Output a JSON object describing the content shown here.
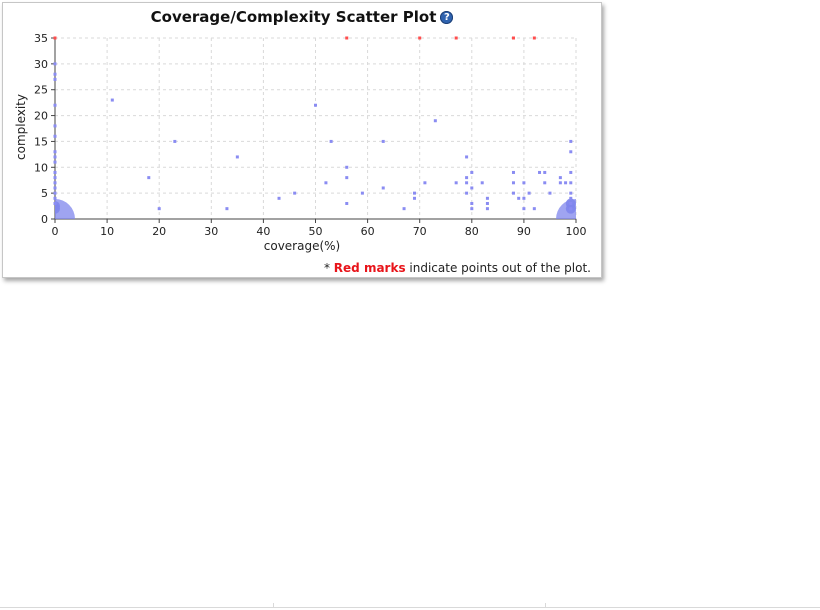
{
  "chart_data": {
    "type": "scatter",
    "title": "Coverage/Complexity Scatter Plot",
    "xlabel": "coverage(%)",
    "ylabel": "complexity",
    "xlim": [
      0,
      100
    ],
    "ylim": [
      0,
      35
    ],
    "xticks": [
      0,
      10,
      20,
      30,
      40,
      50,
      60,
      70,
      80,
      90,
      100
    ],
    "yticks": [
      0,
      5,
      10,
      15,
      20,
      25,
      30,
      35
    ],
    "grid": true,
    "points": [
      {
        "x": 0,
        "y": 30
      },
      {
        "x": 0,
        "y": 28
      },
      {
        "x": 0,
        "y": 27
      },
      {
        "x": 0,
        "y": 22
      },
      {
        "x": 0,
        "y": 18
      },
      {
        "x": 0,
        "y": 16
      },
      {
        "x": 0,
        "y": 13
      },
      {
        "x": 0,
        "y": 12
      },
      {
        "x": 0,
        "y": 11
      },
      {
        "x": 0,
        "y": 9
      },
      {
        "x": 0,
        "y": 8
      },
      {
        "x": 0,
        "y": 7
      },
      {
        "x": 0,
        "y": 6
      },
      {
        "x": 0,
        "y": 5
      },
      {
        "x": 0,
        "y": 4
      },
      {
        "x": 0,
        "y": 3
      },
      {
        "x": 11,
        "y": 23
      },
      {
        "x": 18,
        "y": 8
      },
      {
        "x": 20,
        "y": 2
      },
      {
        "x": 23,
        "y": 15
      },
      {
        "x": 33,
        "y": 2
      },
      {
        "x": 35,
        "y": 12
      },
      {
        "x": 43,
        "y": 4
      },
      {
        "x": 46,
        "y": 5
      },
      {
        "x": 50,
        "y": 22
      },
      {
        "x": 52,
        "y": 7
      },
      {
        "x": 53,
        "y": 15
      },
      {
        "x": 56,
        "y": 10
      },
      {
        "x": 56,
        "y": 8
      },
      {
        "x": 56,
        "y": 3
      },
      {
        "x": 59,
        "y": 5
      },
      {
        "x": 63,
        "y": 15
      },
      {
        "x": 63,
        "y": 6
      },
      {
        "x": 67,
        "y": 2
      },
      {
        "x": 69,
        "y": 5
      },
      {
        "x": 69,
        "y": 4
      },
      {
        "x": 71,
        "y": 7
      },
      {
        "x": 73,
        "y": 19
      },
      {
        "x": 77,
        "y": 7
      },
      {
        "x": 79,
        "y": 12
      },
      {
        "x": 79,
        "y": 8
      },
      {
        "x": 79,
        "y": 7
      },
      {
        "x": 79,
        "y": 5
      },
      {
        "x": 80,
        "y": 9
      },
      {
        "x": 80,
        "y": 6
      },
      {
        "x": 80,
        "y": 3
      },
      {
        "x": 80,
        "y": 2
      },
      {
        "x": 82,
        "y": 7
      },
      {
        "x": 83,
        "y": 4
      },
      {
        "x": 83,
        "y": 3
      },
      {
        "x": 83,
        "y": 2
      },
      {
        "x": 88,
        "y": 9
      },
      {
        "x": 88,
        "y": 7
      },
      {
        "x": 88,
        "y": 5
      },
      {
        "x": 89,
        "y": 4
      },
      {
        "x": 90,
        "y": 7
      },
      {
        "x": 90,
        "y": 4
      },
      {
        "x": 90,
        "y": 2
      },
      {
        "x": 91,
        "y": 5
      },
      {
        "x": 92,
        "y": 2
      },
      {
        "x": 93,
        "y": 9
      },
      {
        "x": 94,
        "y": 9
      },
      {
        "x": 94,
        "y": 7
      },
      {
        "x": 95,
        "y": 5
      },
      {
        "x": 97,
        "y": 8
      },
      {
        "x": 97,
        "y": 7
      },
      {
        "x": 98,
        "y": 7
      },
      {
        "x": 99,
        "y": 15
      },
      {
        "x": 99,
        "y": 13
      },
      {
        "x": 99,
        "y": 9
      },
      {
        "x": 99,
        "y": 7
      },
      {
        "x": 99,
        "y": 5
      },
      {
        "x": 99,
        "y": 4
      },
      {
        "x": 99,
        "y": 3
      },
      {
        "x": 99,
        "y": 2
      }
    ],
    "clusters": [
      {
        "x": 0,
        "y": 2,
        "size": "small"
      },
      {
        "x": 0,
        "y": 2.5,
        "size": "small"
      },
      {
        "x": 0,
        "y": 0,
        "size": "large"
      },
      {
        "x": 99,
        "y": 3,
        "size": "small"
      },
      {
        "x": 99,
        "y": 2,
        "size": "small"
      },
      {
        "x": 100,
        "y": 0,
        "size": "large"
      }
    ],
    "out_of_plot": [
      {
        "x": 0
      },
      {
        "x": 56
      },
      {
        "x": 70
      },
      {
        "x": 77
      },
      {
        "x": 88
      },
      {
        "x": 92
      }
    ],
    "colors": {
      "point": "#8a8cf2",
      "cluster": "#7f86ec",
      "out_of_plot": "#ff4d4d",
      "grid": "#d9d9d9",
      "axis": "#444444"
    }
  },
  "help_icon": "question-mark-icon",
  "footnote": {
    "prefix": "* ",
    "highlight": "Red marks",
    "suffix": " indicate points out of the plot."
  }
}
